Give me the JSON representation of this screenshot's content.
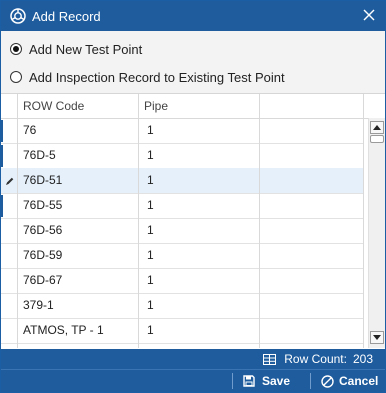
{
  "window": {
    "title": "Add Record",
    "title_icon": "app-logo-icon",
    "close_icon": "close-icon"
  },
  "options": {
    "option1": {
      "label": "Add New Test Point",
      "selected": true
    },
    "option2": {
      "label": "Add Inspection Record to Existing Test Point",
      "selected": false
    }
  },
  "grid": {
    "columns": [
      "ROW Code",
      "Pipe"
    ],
    "rows": [
      {
        "row_code": "76",
        "pipe": "1"
      },
      {
        "row_code": "76D-5",
        "pipe": "1"
      },
      {
        "row_code": "76D-51",
        "pipe": "1"
      },
      {
        "row_code": "76D-55",
        "pipe": "1"
      },
      {
        "row_code": "76D-56",
        "pipe": "1"
      },
      {
        "row_code": "76D-59",
        "pipe": "1"
      },
      {
        "row_code": "76D-67",
        "pipe": "1"
      },
      {
        "row_code": "379-1",
        "pipe": "1"
      },
      {
        "row_code": "ATMOS, TP - 1",
        "pipe": "1"
      }
    ],
    "active_row_index": 2
  },
  "status": {
    "label": "Row Count:",
    "value": "203"
  },
  "footer": {
    "save_label": "Save",
    "cancel_label": "Cancel"
  },
  "colors": {
    "accent": "#1e5c9e",
    "selected_row": "#e5f0fb"
  }
}
